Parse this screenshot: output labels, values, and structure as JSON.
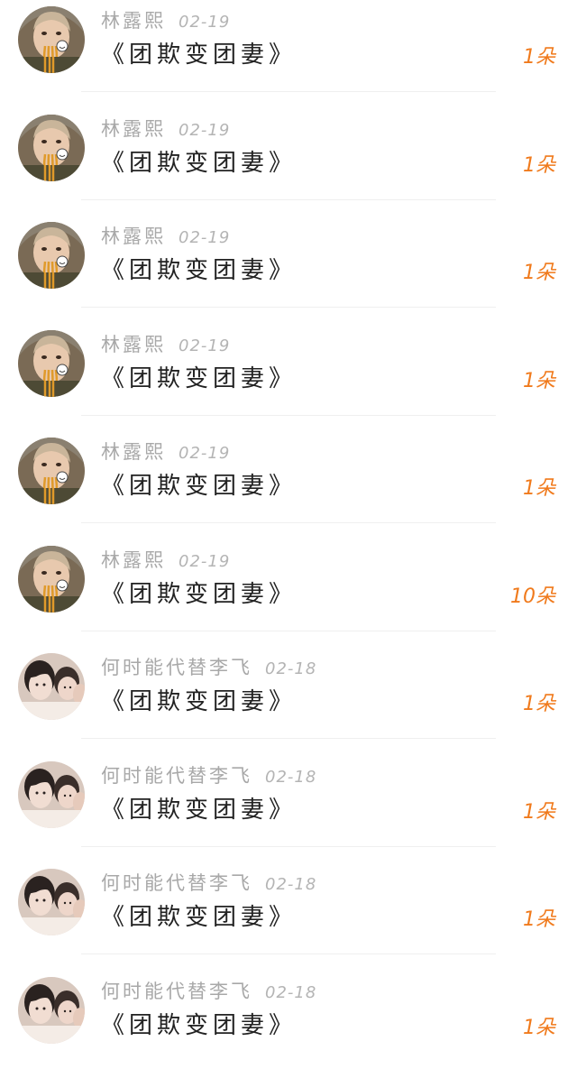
{
  "comments": [
    {
      "user": "林露熙",
      "date": "02-19",
      "work": "《团欺变团妻》",
      "gift": "1朵",
      "avatar": "girl-noodles-avatar"
    },
    {
      "user": "林露熙",
      "date": "02-19",
      "work": "《团欺变团妻》",
      "gift": "1朵",
      "avatar": "girl-noodles-avatar"
    },
    {
      "user": "林露熙",
      "date": "02-19",
      "work": "《团欺变团妻》",
      "gift": "1朵",
      "avatar": "girl-noodles-avatar"
    },
    {
      "user": "林露熙",
      "date": "02-19",
      "work": "《团欺变团妻》",
      "gift": "1朵",
      "avatar": "girl-noodles-avatar"
    },
    {
      "user": "林露熙",
      "date": "02-19",
      "work": "《团欺变团妻》",
      "gift": "1朵",
      "avatar": "girl-noodles-avatar"
    },
    {
      "user": "林露熙",
      "date": "02-19",
      "work": "《团欺变团妻》",
      "gift": "10朵",
      "avatar": "girl-noodles-avatar"
    },
    {
      "user": "何时能代替李飞",
      "date": "02-18",
      "work": "《团欺变团妻》",
      "gift": "1朵",
      "avatar": "boys-group-avatar"
    },
    {
      "user": "何时能代替李飞",
      "date": "02-18",
      "work": "《团欺变团妻》",
      "gift": "1朵",
      "avatar": "boys-group-avatar"
    },
    {
      "user": "何时能代替李飞",
      "date": "02-18",
      "work": "《团欺变团妻》",
      "gift": "1朵",
      "avatar": "boys-group-avatar"
    },
    {
      "user": "何时能代替李飞",
      "date": "02-18",
      "work": "《团欺变团妻》",
      "gift": "1朵",
      "avatar": "boys-group-avatar"
    }
  ],
  "colors": {
    "accent": "#f07a1c",
    "username": "#a8a8a8",
    "title": "#222222"
  }
}
